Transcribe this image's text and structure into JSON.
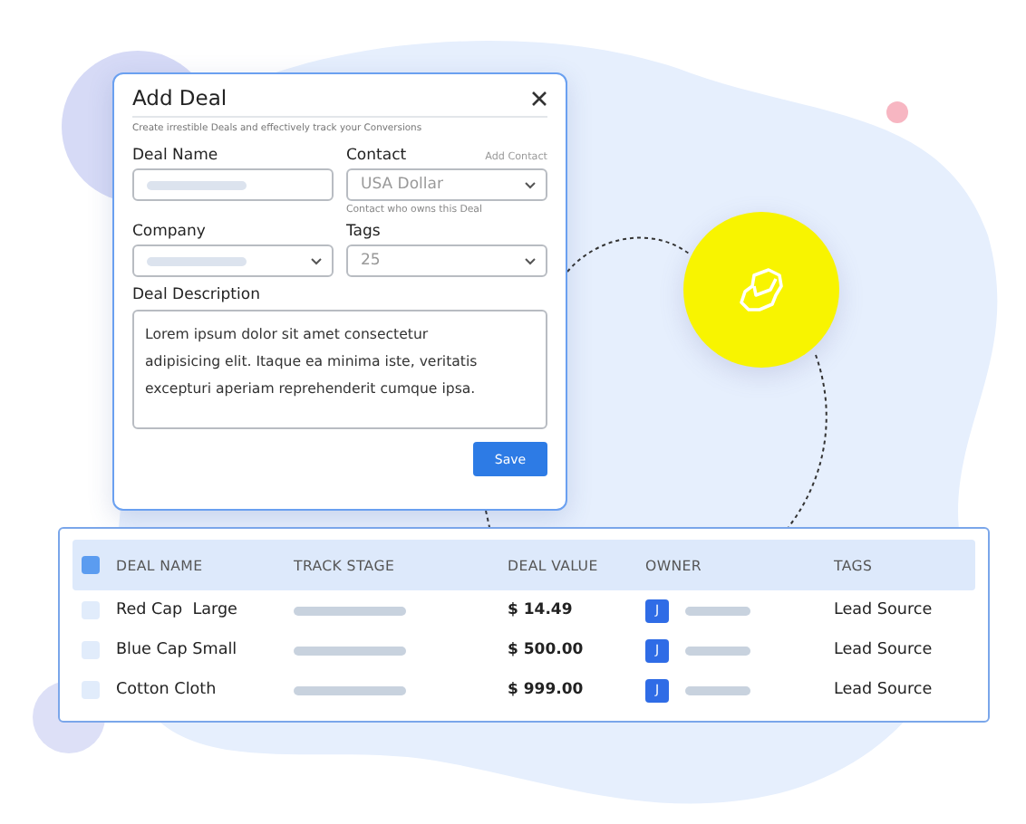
{
  "dialog": {
    "title": "Add Deal",
    "subtitle": "Create irrestible Deals and effectively track your Conversions",
    "fields": [
      {
        "kind": "text",
        "label": "Deal Name"
      },
      {
        "kind": "select",
        "label": "Contact",
        "action": "Add Contact",
        "placeholder": "USA Dollar",
        "hint": "Contact who owns this Deal"
      },
      {
        "kind": "select",
        "label": "Company"
      },
      {
        "kind": "select",
        "label": "Tags",
        "placeholder": "25"
      }
    ],
    "description": {
      "label": "Deal Description",
      "value": "Lorem ipsum dolor sit amet consectetur adipisicing elit. Itaque ea minima iste, veritatis excepturi aperiam reprehenderit cumque ipsa."
    },
    "save_button": "Save"
  },
  "table": {
    "all_selected": true,
    "columns": [
      "DEAL NAME",
      "TRACK STAGE",
      "DEAL VALUE",
      "OWNER",
      "TAGS"
    ],
    "rows": [
      {
        "selected": false,
        "name": "Red Cap  Large",
        "value": "$ 14.49",
        "owner_initial": "J",
        "tags": "Lead Source"
      },
      {
        "selected": false,
        "name": "Blue Cap Small",
        "value": "$ 500.00",
        "owner_initial": "J",
        "tags": "Lead Source"
      },
      {
        "selected": false,
        "name": "Cotton Cloth",
        "value": "$ 999.00",
        "owner_initial": "J",
        "tags": "Lead Source"
      }
    ]
  }
}
